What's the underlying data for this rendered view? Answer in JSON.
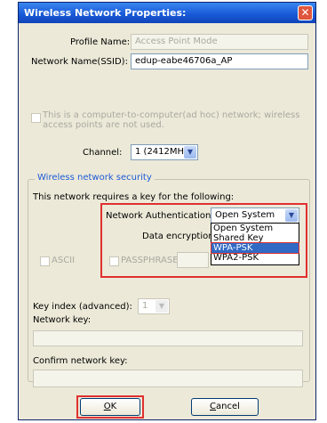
{
  "window": {
    "title": "Wireless Network Properties:",
    "close_glyph": "✕"
  },
  "profile": {
    "label": "Profile Name:",
    "value": "Access Point Mode"
  },
  "ssid": {
    "label": "Network Name(SSID):",
    "value": "edup-eabe46706a_AP"
  },
  "adhoc": {
    "text_line1": "This is a computer-to-computer(ad hoc) network; wireless",
    "text_line2": "access points are not used."
  },
  "channel": {
    "label": "Channel:",
    "value": "1 (2412MHz)"
  },
  "security": {
    "group_title": "Wireless network security",
    "requires_text": "This network requires a key for the following:",
    "auth_label": "Network Authentication:",
    "auth_value": "Open System",
    "auth_options": [
      "Open System",
      "Shared Key",
      "WPA-PSK",
      "WPA2-PSK"
    ],
    "selected_option": "WPA-PSK",
    "encryption_label": "Data encryption:",
    "ascii_label": "ASCII",
    "passphrase_label": "PASSPHRASE",
    "key_index_label": "Key index (advanced):",
    "key_index_value": "1",
    "network_key_label": "Network key:",
    "confirm_key_label": "Confirm network key:"
  },
  "buttons": {
    "ok_rest": "K",
    "ok_mnemonic": "O",
    "cancel_mnemonic": "C",
    "cancel_rest": "ancel"
  },
  "colors": {
    "highlight": "#e03030",
    "title_bar": "#1757d6",
    "selection": "#316ac5"
  }
}
